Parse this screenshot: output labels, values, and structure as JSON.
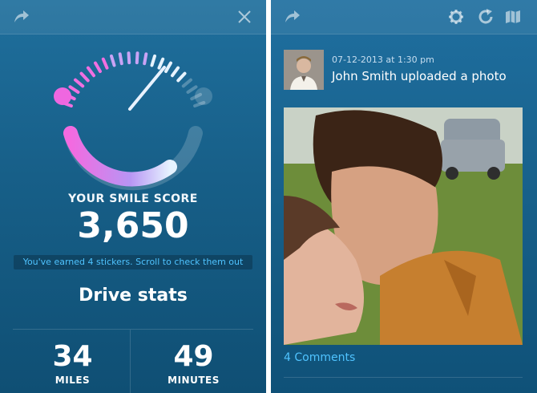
{
  "left_screen": {
    "toolbar": {
      "share_icon": "share-arrow-icon",
      "close_icon": "close-icon"
    },
    "score_label": "YOUR SMILE SCORE",
    "score_value": "3,650",
    "sticker_message": "You've earned 4 stickers. Scroll to check them out",
    "section_title": "Drive stats",
    "stats": [
      {
        "value": "34",
        "unit": "MILES"
      },
      {
        "value": "49",
        "unit": "MINUTES"
      }
    ],
    "gauge": {
      "accent_pink": "#e86be6",
      "accent_purple": "#b48cf0",
      "accent_light": "#d9ecff"
    }
  },
  "right_screen": {
    "toolbar": {
      "share_icon": "share-arrow-icon",
      "settings_icon": "gear-icon",
      "refresh_icon": "refresh-icon",
      "map_icon": "map-icon"
    },
    "post": {
      "timestamp": "07-12-2013 at 1:30 pm",
      "title": "John Smith uploaded a photo",
      "comments_label": "4 Comments"
    }
  },
  "colors": {
    "link": "#4fc3ff",
    "panel": "#17608a"
  }
}
